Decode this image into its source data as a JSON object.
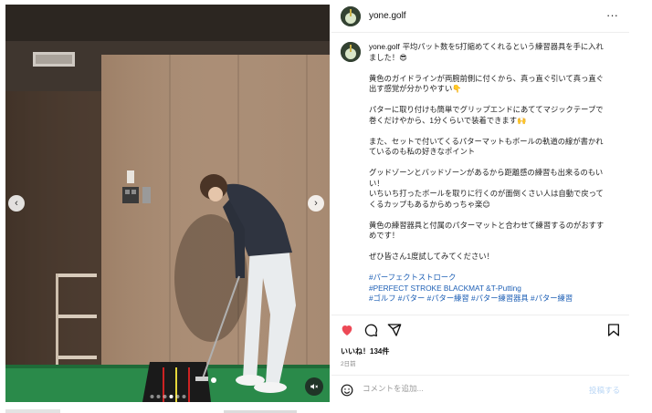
{
  "post": {
    "username": "yone.golf",
    "more_icon": "···"
  },
  "caption": {
    "username": "yone.golf",
    "lines": [
      "平均パット数を5打縮めてくれるという練習器具を手に入れました！😎",
      "黄色のガイドラインが両腕前側に付くから、真っ直ぐ引いて真っ直ぐ出す感覚が分かりやすい👇",
      "パターに取り付けも簡単でグリップエンドにあててマジックテープで巻くだけやから、1分くらいで装着できます🙌",
      "また、セットで付いてくるパターマットもボールの軌道の線が書かれているのも私の好きなポイント",
      "グッドゾーンとバッドゾーンがあるから距離感の練習も出来るのもいい！\nいちいち打ったボールを取りに行くのが面倒くさい人は自動で戻ってくるカップもあるからめっちゃ楽😊",
      "黄色の練習器具と付属のパターマットと合わせて練習するのがおすすめです！",
      "ぜひ皆さん1度試してみてください！"
    ],
    "hashtags": [
      "#パーフェクトストローク",
      "#PERFECT STROKE BLACKMAT &T-Putting",
      "#ゴルフ #パター #パター練習 #パター練習器具 #パター練習"
    ]
  },
  "actions": {
    "like_icon": "heart-icon",
    "comment_icon": "comment-icon",
    "share_icon": "share-icon",
    "save_icon": "bookmark-icon",
    "like_color": "#ed4956"
  },
  "likes_text": "いいね！134件",
  "date_text": "2日前",
  "comment": {
    "placeholder": "コメントを追加...",
    "post_label": "投稿する"
  },
  "carousel": {
    "prev_label": "‹",
    "next_label": "›",
    "slide_count": 6,
    "active_slide": 4
  }
}
